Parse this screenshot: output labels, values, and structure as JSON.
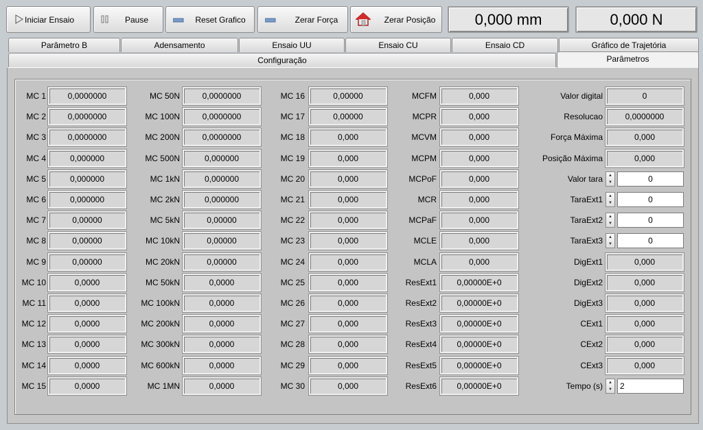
{
  "toolbar": {
    "iniciar": "Iniciar Ensaio",
    "pause": "Pause",
    "reset": "Reset Grafico",
    "zerar_forca": "Zerar Força",
    "zerar_posicao": "Zerar Posição",
    "position_readout": "0,000 mm",
    "force_readout": "0,000 N"
  },
  "tabs_row1": [
    "Parâmetro B",
    "Adensamento",
    "Ensaio UU",
    "Ensaio CU",
    "Ensaio CD",
    "Gráfico de Trajetória"
  ],
  "tabs_row2": [
    "Configuração",
    "Parâmetros"
  ],
  "active_tab": "Parâmetros",
  "col1": [
    {
      "label": "MC 1",
      "value": "0,0000000"
    },
    {
      "label": "MC 2",
      "value": "0,0000000"
    },
    {
      "label": "MC 3",
      "value": "0,0000000"
    },
    {
      "label": "MC 4",
      "value": "0,000000"
    },
    {
      "label": "MC 5",
      "value": "0,000000"
    },
    {
      "label": "MC 6",
      "value": "0,000000"
    },
    {
      "label": "MC 7",
      "value": "0,00000"
    },
    {
      "label": "MC 8",
      "value": "0,00000"
    },
    {
      "label": "MC 9",
      "value": "0,00000"
    },
    {
      "label": "MC 10",
      "value": "0,0000"
    },
    {
      "label": "MC 11",
      "value": "0,0000"
    },
    {
      "label": "MC 12",
      "value": "0,0000"
    },
    {
      "label": "MC 13",
      "value": "0,0000"
    },
    {
      "label": "MC 14",
      "value": "0,0000"
    },
    {
      "label": "MC 15",
      "value": "0,0000"
    }
  ],
  "col2": [
    {
      "label": "MC 50N",
      "value": "0,0000000"
    },
    {
      "label": "MC 100N",
      "value": "0,0000000"
    },
    {
      "label": "MC 200N",
      "value": "0,0000000"
    },
    {
      "label": "MC 500N",
      "value": "0,000000"
    },
    {
      "label": "MC 1kN",
      "value": "0,000000"
    },
    {
      "label": "MC 2kN",
      "value": "0,000000"
    },
    {
      "label": "MC 5kN",
      "value": "0,00000"
    },
    {
      "label": "MC 10kN",
      "value": "0,00000"
    },
    {
      "label": "MC 20kN",
      "value": "0,00000"
    },
    {
      "label": "MC 50kN",
      "value": "0,0000"
    },
    {
      "label": "MC 100kN",
      "value": "0,0000"
    },
    {
      "label": "MC 200kN",
      "value": "0,0000"
    },
    {
      "label": "MC 300kN",
      "value": "0,0000"
    },
    {
      "label": "MC 600kN",
      "value": "0,0000"
    },
    {
      "label": "MC 1MN",
      "value": "0,0000"
    }
  ],
  "col3": [
    {
      "label": "MC 16",
      "value": "0,00000"
    },
    {
      "label": "MC 17",
      "value": "0,00000"
    },
    {
      "label": "MC 18",
      "value": "0,000"
    },
    {
      "label": "MC 19",
      "value": "0,000"
    },
    {
      "label": "MC 20",
      "value": "0,000"
    },
    {
      "label": "MC 21",
      "value": "0,000"
    },
    {
      "label": "MC 22",
      "value": "0,000"
    },
    {
      "label": "MC 23",
      "value": "0,000"
    },
    {
      "label": "MC 24",
      "value": "0,000"
    },
    {
      "label": "MC 25",
      "value": "0,000"
    },
    {
      "label": "MC 26",
      "value": "0,000"
    },
    {
      "label": "MC 27",
      "value": "0,000"
    },
    {
      "label": "MC 28",
      "value": "0,000"
    },
    {
      "label": "MC 29",
      "value": "0,000"
    },
    {
      "label": "MC 30",
      "value": "0,000"
    }
  ],
  "col4": [
    {
      "label": "MCFM",
      "value": "0,000"
    },
    {
      "label": "MCPR",
      "value": "0,000"
    },
    {
      "label": "MCVM",
      "value": "0,000"
    },
    {
      "label": "MCPM",
      "value": "0,000"
    },
    {
      "label": "MCPoF",
      "value": "0,000"
    },
    {
      "label": "MCR",
      "value": "0,000"
    },
    {
      "label": "MCPaF",
      "value": "0,000"
    },
    {
      "label": "MCLE",
      "value": "0,000"
    },
    {
      "label": "MCLA",
      "value": "0,000"
    },
    {
      "label": "ResExt1",
      "value": "0,00000E+0"
    },
    {
      "label": "ResExt2",
      "value": "0,00000E+0"
    },
    {
      "label": "ResExt3",
      "value": "0,00000E+0"
    },
    {
      "label": "ResExt4",
      "value": "0,00000E+0"
    },
    {
      "label": "ResExt5",
      "value": "0,00000E+0"
    },
    {
      "label": "ResExt6",
      "value": "0,00000E+0"
    }
  ],
  "col5": [
    {
      "label": "Valor digital",
      "value": "0",
      "kind": "ro"
    },
    {
      "label": "Resolucao",
      "value": "0,0000000",
      "kind": "ro"
    },
    {
      "label": "Força Máxima",
      "value": "0,000",
      "kind": "ro"
    },
    {
      "label": "Posição Máxima",
      "value": "0,000",
      "kind": "ro"
    },
    {
      "label": "Valor tara",
      "value": "0",
      "kind": "spin"
    },
    {
      "label": "TaraExt1",
      "value": "0",
      "kind": "spin"
    },
    {
      "label": "TaraExt2",
      "value": "0",
      "kind": "spin"
    },
    {
      "label": "TaraExt3",
      "value": "0",
      "kind": "spin"
    },
    {
      "label": "DigExt1",
      "value": "0,000",
      "kind": "ro"
    },
    {
      "label": "DigExt2",
      "value": "0,000",
      "kind": "ro"
    },
    {
      "label": "DigExt3",
      "value": "0,000",
      "kind": "ro"
    },
    {
      "label": "CExt1",
      "value": "0,000",
      "kind": "ro"
    },
    {
      "label": "CExt2",
      "value": "0,000",
      "kind": "ro"
    },
    {
      "label": "CExt3",
      "value": "0,000",
      "kind": "ro"
    },
    {
      "label": "Tempo (s)",
      "value": "2",
      "kind": "spin-left"
    }
  ]
}
